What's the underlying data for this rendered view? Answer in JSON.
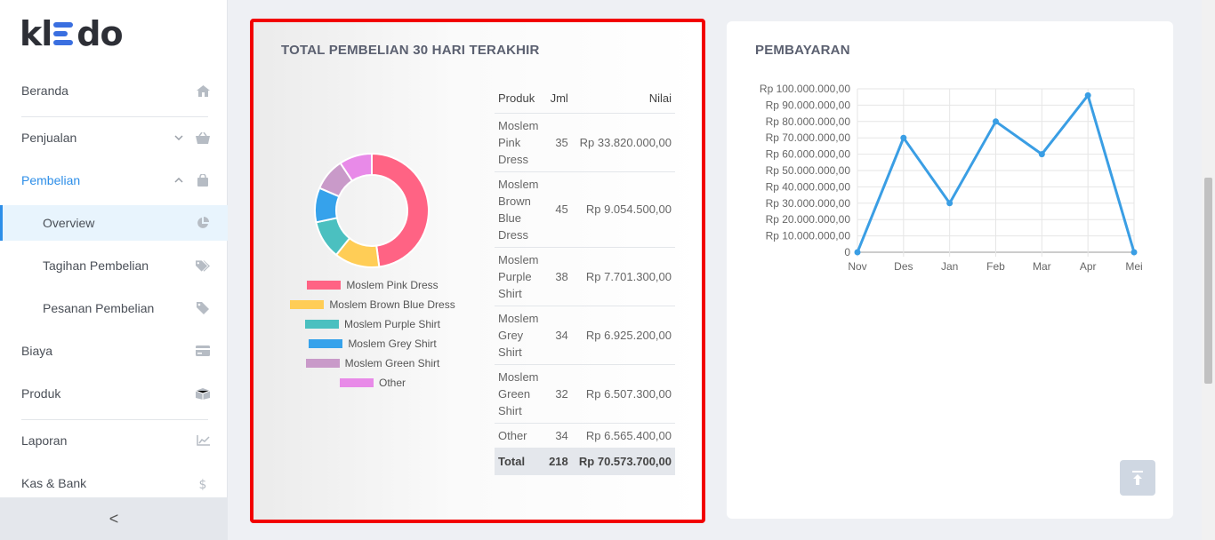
{
  "brand": {
    "logo_text_left": "kl",
    "logo_text_right": "do"
  },
  "sidebar": {
    "items": [
      {
        "label": "Beranda",
        "icon": "home-icon"
      },
      {
        "label": "Penjualan",
        "icon": "basket-icon"
      },
      {
        "label": "Pembelian",
        "icon": "bag-icon"
      },
      {
        "label": "Overview",
        "icon": "pie-icon"
      },
      {
        "label": "Tagihan Pembelian",
        "icon": "tags-icon"
      },
      {
        "label": "Pesanan Pembelian",
        "icon": "tag-icon"
      },
      {
        "label": "Biaya",
        "icon": "card-icon"
      },
      {
        "label": "Produk",
        "icon": "box-icon"
      },
      {
        "label": "Laporan",
        "icon": "chart-icon"
      },
      {
        "label": "Kas & Bank",
        "icon": "dollar-icon"
      }
    ],
    "collapse_label": "<"
  },
  "purchase_card": {
    "title": "TOTAL PEMBELIAN 30 HARI TERAKHIR",
    "table": {
      "headers": [
        "Produk",
        "Jml",
        "Nilai"
      ],
      "rows": [
        {
          "product": "Moslem Pink Dress",
          "qty": "35",
          "value": "Rp 33.820.000,00"
        },
        {
          "product": "Moslem Brown Blue Dress",
          "qty": "45",
          "value": "Rp 9.054.500,00"
        },
        {
          "product": "Moslem Purple Shirt",
          "qty": "38",
          "value": "Rp 7.701.300,00"
        },
        {
          "product": "Moslem Grey Shirt",
          "qty": "34",
          "value": "Rp 6.925.200,00"
        },
        {
          "product": "Moslem Green Shirt",
          "qty": "32",
          "value": "Rp 6.507.300,00"
        },
        {
          "product": "Other",
          "qty": "34",
          "value": "Rp 6.565.400,00"
        }
      ],
      "total": {
        "label": "Total",
        "qty": "218",
        "value": "Rp 70.573.700,00"
      }
    }
  },
  "payment_card": {
    "title": "PEMBAYARAN"
  },
  "chart_data": [
    {
      "type": "pie",
      "categories": [
        "Moslem Pink Dress",
        "Moslem Brown Blue Dress",
        "Moslem Purple Shirt",
        "Moslem Grey Shirt",
        "Moslem Green Shirt",
        "Other"
      ],
      "values": [
        33820000,
        9054500,
        7701300,
        6925200,
        6507300,
        6565400
      ],
      "colors": [
        "#ff6384",
        "#ffcd56",
        "#4bc0c0",
        "#36a2eb",
        "#c99ac9",
        "#e88ae8"
      ],
      "legend": "bottom"
    },
    {
      "type": "line",
      "title": "",
      "x": [
        "Nov",
        "Des",
        "Jan",
        "Feb",
        "Mar",
        "Apr",
        "Mei"
      ],
      "series": [
        {
          "values": [
            0,
            70000000,
            30000000,
            80000000,
            60000000,
            96000000,
            0
          ],
          "color": "#3a9ee4"
        }
      ],
      "ylim": [
        0,
        100000000
      ],
      "yticks": [
        "0",
        "Rp 10.000.000,00",
        "Rp 20.000.000,00",
        "Rp 30.000.000,00",
        "Rp 40.000.000,00",
        "Rp 50.000.000,00",
        "Rp 60.000.000,00",
        "Rp 70.000.000,00",
        "Rp 80.000.000,00",
        "Rp 90.000.000,00",
        "Rp 100.000.000,00"
      ],
      "grid": true
    }
  ]
}
